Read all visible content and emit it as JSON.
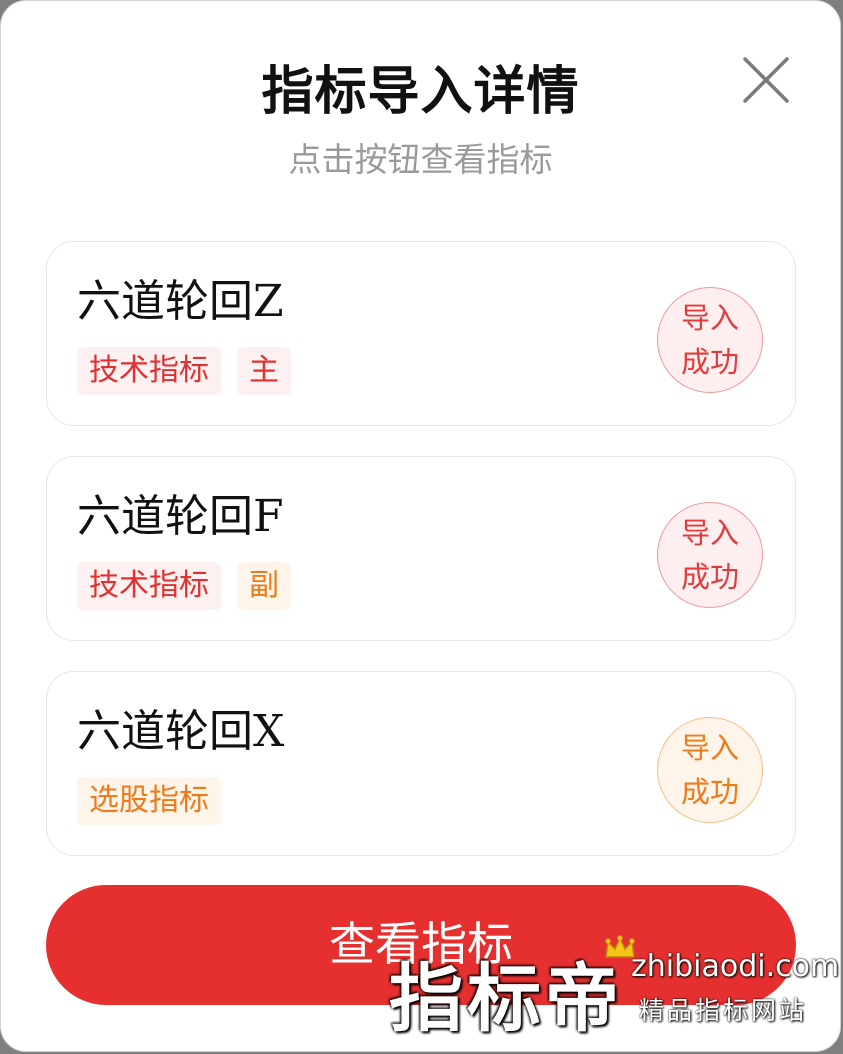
{
  "dialog": {
    "title": "指标导入详情",
    "subtitle": "点击按钮查看指标"
  },
  "icons": {
    "close": "close-icon",
    "crown": "crown-icon"
  },
  "colors": {
    "primary_red": "#e63030",
    "tag_red": "#e03131",
    "tag_orange": "#ee7a1a"
  },
  "indicators": [
    {
      "name": "六道轮回Z",
      "tags": [
        "技术指标",
        "主"
      ],
      "status_line1": "导入",
      "status_line2": "成功"
    },
    {
      "name": "六道轮回F",
      "tags": [
        "技术指标",
        "副"
      ],
      "status_line1": "导入",
      "status_line2": "成功"
    },
    {
      "name": "六道轮回X",
      "tags": [
        "选股指标"
      ],
      "status_line1": "导入",
      "status_line2": "成功"
    }
  ],
  "button": {
    "label": "查看指标"
  },
  "watermark": {
    "brand": "指标帝",
    "domain": "zhibiaodi.com",
    "slogan": "精品指标网站"
  }
}
